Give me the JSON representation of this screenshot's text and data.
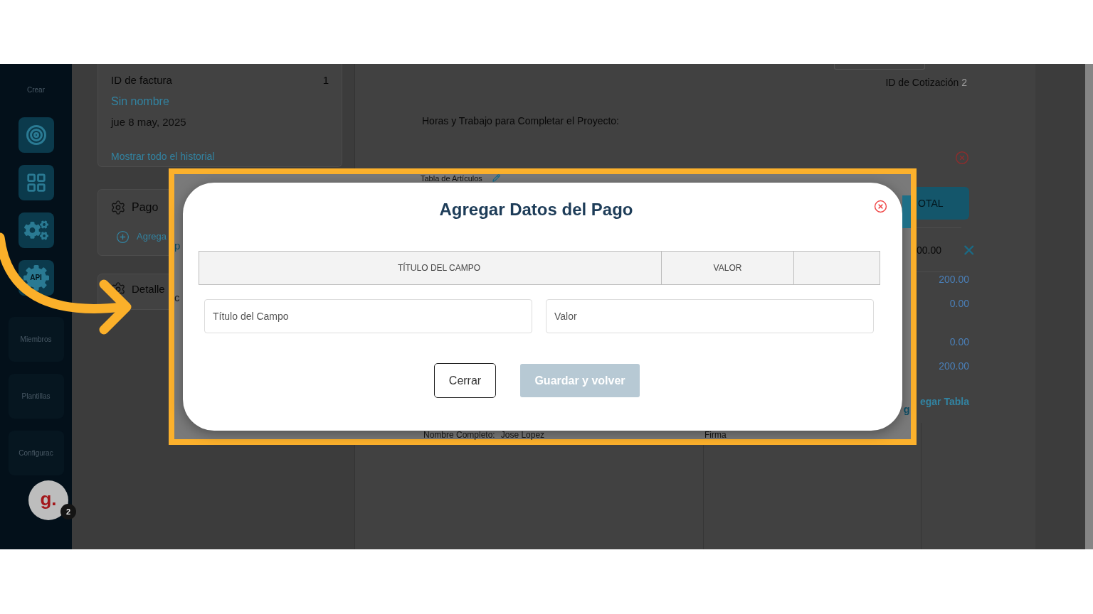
{
  "sidebar": {
    "section_label": "Crear",
    "tool_buttons": [
      {
        "kind": "target"
      },
      {
        "kind": "grid"
      },
      {
        "kind": "gears"
      },
      {
        "kind": "api",
        "label": "API"
      }
    ],
    "items": [
      {
        "label": "Miembros"
      },
      {
        "label": "Plantillas"
      },
      {
        "label": "Configurac"
      }
    ],
    "avatar": {
      "logo": "g.",
      "badge": "2"
    }
  },
  "invoice_card": {
    "id_label": "ID de factura",
    "id_value": "1",
    "name": "Sin nombre",
    "date": "jue 8 may, 2025",
    "history_link": "Mostrar todo el historial"
  },
  "payment_card": {
    "title": "Pago",
    "add_link": "Agrega"
  },
  "details_card": {
    "title": "Detalle"
  },
  "document": {
    "quote_id_label": "ID de Cotización",
    "quote_id": "2",
    "hours_label": "Horas y Trabajo para Completar el Proyecto:",
    "total_button": "OTAL",
    "amount_cell": "00.00",
    "amounts": [
      "200.00",
      "0.00",
      "0.00",
      "200.00"
    ],
    "add_table_link": "egar Tabla"
  },
  "highlight": {
    "top_text": "Tabla de Artículos",
    "left_texts": [
      "p",
      "c"
    ],
    "right_text": "g",
    "bottom_label": "Nombre Completo:",
    "bottom_value": "Jose Lopez",
    "signature_label": "Firma"
  },
  "modal": {
    "title": "Agregar Datos del Pago",
    "columns": [
      "TÍTULO DEL CAMPO",
      "VALOR"
    ],
    "fields": [
      {
        "placeholder": "Título del Campo"
      },
      {
        "placeholder": "Valor"
      }
    ],
    "buttons": [
      {
        "label": "Cerrar",
        "kind": "secondary",
        "disabled": false
      },
      {
        "label": "Guardar y volver",
        "kind": "primary",
        "disabled": true
      }
    ]
  }
}
